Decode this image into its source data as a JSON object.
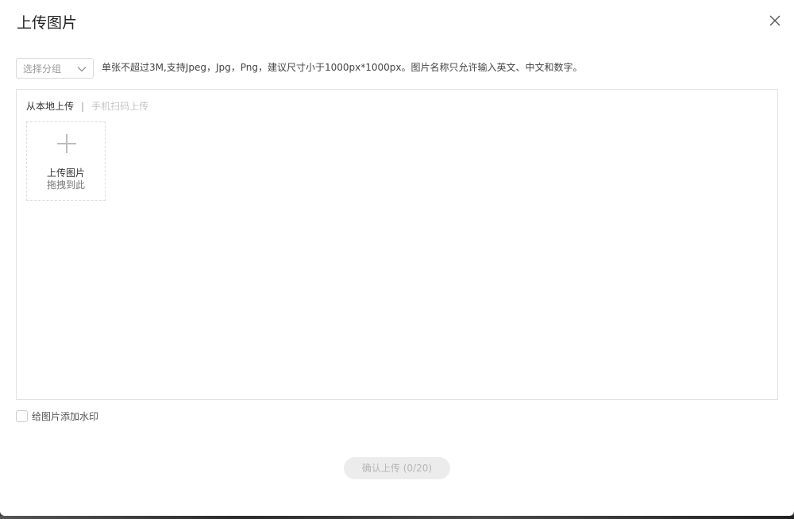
{
  "dialog": {
    "title": "上传图片",
    "close_icon": "close-icon"
  },
  "toolbar": {
    "group_select": {
      "placeholder": "选择分组",
      "icon": "chevron-down-icon"
    },
    "hint": "单张不超过3M,支持Jpeg，Jpg，Png，建议尺寸小于1000px*1000px。图片名称只允许输入英文、中文和数字。"
  },
  "tabs": {
    "local": "从本地上传",
    "separator": "|",
    "mobile": "手机扫码上传"
  },
  "uploader": {
    "icon": "plus-icon",
    "line1": "上传图片",
    "line2": "拖拽到此"
  },
  "watermark": {
    "label": "给图片添加水印",
    "checked": false
  },
  "footer": {
    "confirm_label": "确认上传 (0/20)"
  },
  "colors": {
    "disabled_bg": "#ececec",
    "disabled_text": "#b5b5b5",
    "border": "#e2e2e2"
  }
}
